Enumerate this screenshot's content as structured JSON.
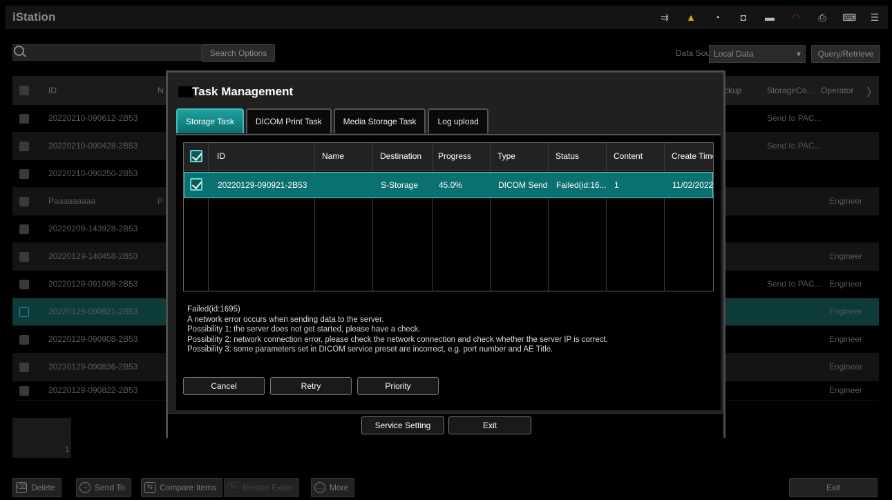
{
  "app": {
    "title": "iStation"
  },
  "search": {
    "placeholder": "",
    "options_label": "Search Options"
  },
  "data_source": {
    "label": "Data Source:",
    "value": "Local Data",
    "query_label": "Query/Retrieve"
  },
  "bg_table": {
    "headers": {
      "id": "ID",
      "name": "N",
      "backup": "ckup",
      "storage": "StorageCo...",
      "operator": "Operator"
    },
    "rows": [
      {
        "id": "20220210-090612-2B53",
        "name": "",
        "storage": "Send to PAC...",
        "operator": ""
      },
      {
        "id": "20220210-090428-2B53",
        "name": "",
        "storage": "Send to PAC...",
        "operator": ""
      },
      {
        "id": "20220210-090250-2B53",
        "name": "",
        "storage": "",
        "operator": ""
      },
      {
        "id": "Paaaaaaaaa",
        "name": "P",
        "storage": "",
        "operator": "Engineer"
      },
      {
        "id": "20220209-143928-2B53",
        "name": "",
        "storage": "",
        "operator": ""
      },
      {
        "id": "20220129-140458-2B53",
        "name": "",
        "storage": "",
        "operator": "Engineer"
      },
      {
        "id": "20220129-091008-2B53",
        "name": "",
        "storage": "Send to PAC...",
        "operator": "Engineer"
      },
      {
        "id": "20220129-090921-2B53",
        "name": "",
        "storage": "",
        "operator": "Engineer"
      },
      {
        "id": "20220129-090908-2B53",
        "name": "",
        "storage": "",
        "operator": "Engineer"
      },
      {
        "id": "20220129-090836-2B53",
        "name": "",
        "storage": "",
        "operator": "Engineer"
      },
      {
        "id": "20220129-090822-2B53",
        "name": "",
        "storage": "",
        "operator": "Engineer"
      }
    ],
    "page": "1"
  },
  "bottom": {
    "delete": "Delete",
    "send_to": "Send To",
    "compare": "Compare Items",
    "restart": "Restart Exam",
    "more": "More",
    "exit": "Exit"
  },
  "dialog": {
    "title": "Task Management",
    "tabs": [
      "Storage Task",
      "DICOM Print Task",
      "Media Storage Task",
      "Log upload"
    ],
    "columns": [
      "ID",
      "Name",
      "Destination",
      "Progress",
      "Type",
      "Status",
      "Content",
      "Create Time"
    ],
    "task": {
      "id": "20220129-090921-2B53",
      "name": "",
      "destination": "S-Storage",
      "progress": "45.0%",
      "type": "DICOM Send",
      "status": "Failed(id:16...",
      "content": "1",
      "create_time": "11/02/2022"
    },
    "message": [
      "Failed(id:1695)",
      "A network error occurs when sending data to the server.",
      "Possibility 1: the server does not get started, please have a check.",
      "Possibility 2: network connection error, please check the network connection and check whether the server IP is correct.",
      "Possibility 3: some parameters set in DICOM service preset are incorrect, e.g. port number and AE Title."
    ],
    "buttons": {
      "cancel": "Cancel",
      "retry": "Retry",
      "priority": "Priority"
    },
    "footer": {
      "service": "Service Setting",
      "exit": "Exit"
    }
  }
}
